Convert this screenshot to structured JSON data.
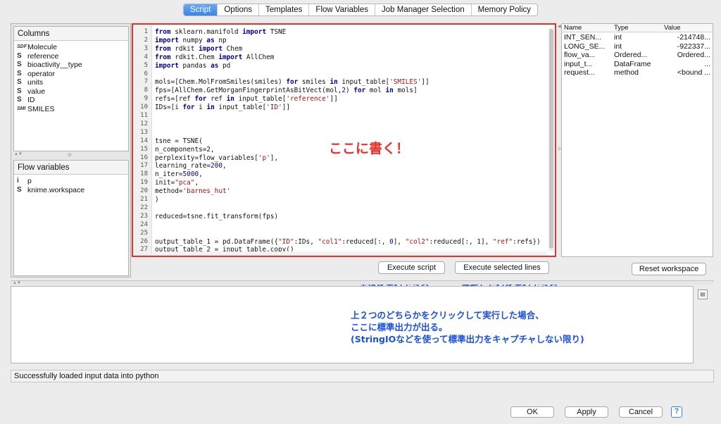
{
  "tabs": [
    "Script",
    "Options",
    "Templates",
    "Flow Variables",
    "Job Manager Selection",
    "Memory Policy"
  ],
  "columns_panel": {
    "title": "Columns",
    "items": [
      {
        "icon": "SDF",
        "label": "Molecule"
      },
      {
        "icon": "S",
        "label": "reference"
      },
      {
        "icon": "S",
        "label": "bioactivity__type"
      },
      {
        "icon": "S",
        "label": "operator"
      },
      {
        "icon": "S",
        "label": "units"
      },
      {
        "icon": "S",
        "label": "value"
      },
      {
        "icon": "S",
        "label": "ID"
      },
      {
        "icon": "SMI",
        "label": "SMILES"
      }
    ]
  },
  "flow_panel": {
    "title": "Flow variables",
    "items": [
      {
        "icon": "i",
        "label": "p"
      },
      {
        "icon": "S",
        "label": "knime.workspace"
      }
    ]
  },
  "editor": {
    "line_numbers": [
      "1",
      "2",
      "3",
      "4",
      "5",
      "6",
      "7",
      "8",
      "9",
      "10",
      "11",
      "12",
      "13",
      "14",
      "15",
      "16",
      "17",
      "18",
      "19",
      "20",
      "21",
      "22",
      "23",
      "24",
      "25",
      "26",
      "27"
    ],
    "code_lines": [
      "from sklearn.manifold import TSNE",
      "import numpy as np",
      "from rdkit import Chem",
      "from rdkit.Chem import AllChem",
      "import pandas as pd",
      "",
      "mols=[Chem.MolFromSmiles(smiles) for smiles in input_table['SMILES']]",
      "fps=[AllChem.GetMorganFingerprintAsBitVect(mol,2) for mol in mols]",
      "refs=[ref for ref in input_table['reference']]",
      "IDs=[i for i in input_table['ID']]",
      "",
      "",
      "",
      "tsne = TSNE(",
      "n_components=2,",
      "perplexity=flow_variables['p'],",
      "learning_rate=200,",
      "n_iter=5000,",
      "init=\"pca\",",
      "method='barnes_hut'",
      ")",
      "",
      "reduced=tsne.fit_transform(fps)",
      "",
      "",
      "output_table_1 = pd.DataFrame({\"ID\":IDs, \"col1\":reduced[:, 0], \"col2\":reduced[:, 1], \"ref\":refs})",
      "output_table_2 = input_table.copy()"
    ]
  },
  "buttons": {
    "execute_script": "Execute script",
    "execute_selected": "Execute selected lines",
    "reset_workspace": "Reset workspace",
    "ok": "OK",
    "apply": "Apply",
    "cancel": "Cancel",
    "help": "?"
  },
  "workspace": {
    "headers": [
      "Name",
      "Type",
      "Value"
    ],
    "rows": [
      [
        "INT_SEN...",
        "int",
        "-214748..."
      ],
      [
        "LONG_SE...",
        "int",
        "-922337..."
      ],
      [
        "flow_va...",
        "Ordered...",
        "Ordered..."
      ],
      [
        "input_t...",
        "DataFrame",
        "..."
      ],
      [
        "request...",
        "method",
        "<bound ..."
      ]
    ]
  },
  "status": "Successfully loaded input data into python",
  "annotations": {
    "write_here": "ここに書く！",
    "run_all": "全体を実行できる",
    "run_selected": "選択した行を実行できる",
    "console_note_1": "上２つのどちらかをクリックして実行した場合、",
    "console_note_2": "ここに標準出力が出る。",
    "console_note_3": "(StringIOなどを使って標準出力をキャプチャしない限り)"
  },
  "colors": {
    "annotation_red": "#e8312a",
    "annotation_blue": "#1a4fe0",
    "tab_active": "#3a83e6"
  }
}
